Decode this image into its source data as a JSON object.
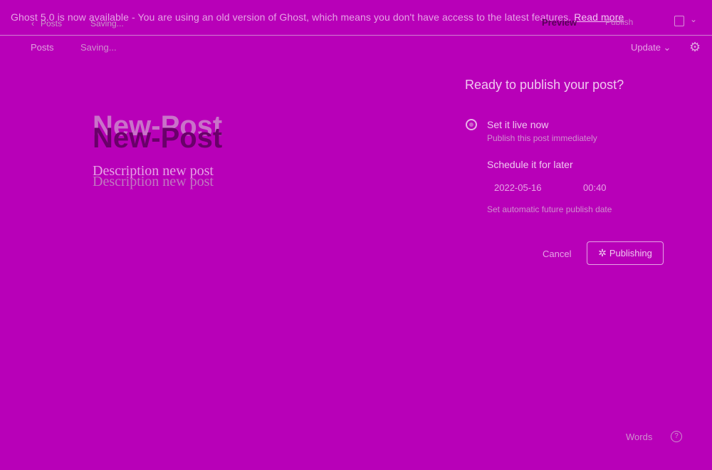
{
  "banner": {
    "text": "Ghost 5.0 is now available - You are using an old version of Ghost, which means you don't have access to the latest features.",
    "link": "Read more"
  },
  "ghost_header": {
    "posts": "Posts",
    "saving": "Saving...",
    "preview": "Preview",
    "publish": "Publish"
  },
  "nav": {
    "posts": "Posts",
    "saving": "Saving...",
    "update": "Update"
  },
  "editor": {
    "title": "New-Post",
    "description": "Description new post"
  },
  "publish_panel": {
    "heading": "Ready to publish your post?",
    "option_now": "Set it live now",
    "option_now_sub": "Publish this post immediately",
    "option_later": "Schedule it for later",
    "date": "2022-05-16",
    "time": "00:40",
    "schedule_hint": "Set automatic future publish date",
    "cancel": "Cancel",
    "publishing": "Publishing"
  },
  "footer": {
    "label": "Words"
  }
}
